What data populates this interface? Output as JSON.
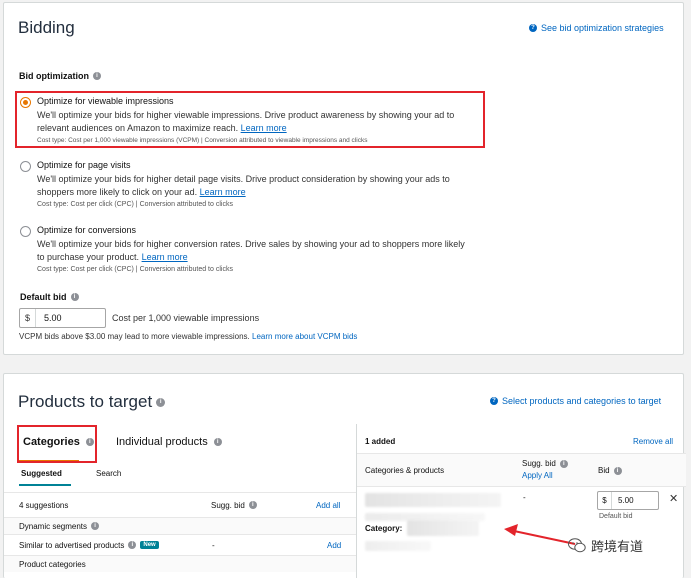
{
  "bidding": {
    "title": "Bidding",
    "strategies_link": "See bid optimization strategies",
    "bid_optimization_label": "Bid optimization",
    "options": [
      {
        "title": "Optimize for viewable impressions",
        "desc": "We'll optimize your bids for higher viewable impressions. Drive product awareness by showing your ad to relevant audiences on Amazon to maximize reach.",
        "learn_more": "Learn more",
        "cost": "Cost type: Cost per 1,000 viewable impressions (VCPM) | Conversion attributed to viewable impressions and clicks",
        "checked": true
      },
      {
        "title": "Optimize for page visits",
        "desc": "We'll optimize your bids for higher detail page visits. Drive product consideration by showing your ads to shoppers more likely to click on your ad.",
        "learn_more": "Learn more",
        "cost": "Cost type: Cost per click (CPC) | Conversion attributed to clicks",
        "checked": false
      },
      {
        "title": "Optimize for conversions",
        "desc": "We'll optimize your bids for higher conversion rates. Drive sales by showing your ad to shoppers more likely to purchase your product.",
        "learn_more": "Learn more",
        "cost": "Cost type: Cost per click (CPC) | Conversion attributed to clicks",
        "checked": false
      }
    ],
    "default_bid_label": "Default bid",
    "currency": "$",
    "default_bid_value": "5.00",
    "default_bid_caption": "Cost per 1,000 viewable impressions",
    "vcpm_note": "VCPM bids above $3.00 may lead to more viewable impressions.",
    "vcpm_link": "Learn more about VCPM bids"
  },
  "products": {
    "title": "Products to target",
    "select_link": "Select products and categories to target",
    "tabs": [
      "Categories",
      "Individual products"
    ],
    "subtabs": [
      "Suggested",
      "Search"
    ],
    "suggestions_count": "4 suggestions",
    "sugg_bid_col": "Sugg. bid",
    "add_all": "Add all",
    "rows": [
      {
        "label": "Dynamic segments",
        "type": "group"
      },
      {
        "label": "Similar to advertised products",
        "badge": "New",
        "bid": "-",
        "action": "Add"
      },
      {
        "label": "Product categories",
        "type": "group"
      }
    ],
    "added_count": "1 added",
    "remove_all": "Remove all",
    "rp_col_cat": "Categories & products",
    "rp_col_sugg": "Sugg. bid",
    "apply_all": "Apply All",
    "rp_col_bid": "Bid",
    "row_sugg": "-",
    "row_currency": "$",
    "row_bid": "5.00",
    "default_bid_small": "Default bid",
    "category_label": "Category:"
  },
  "watermark": {
    "text": "跨境有道"
  },
  "colors": {
    "accent": "#e77600",
    "link": "#0066c0",
    "highlight": "#e3242b",
    "teal": "#008296"
  }
}
